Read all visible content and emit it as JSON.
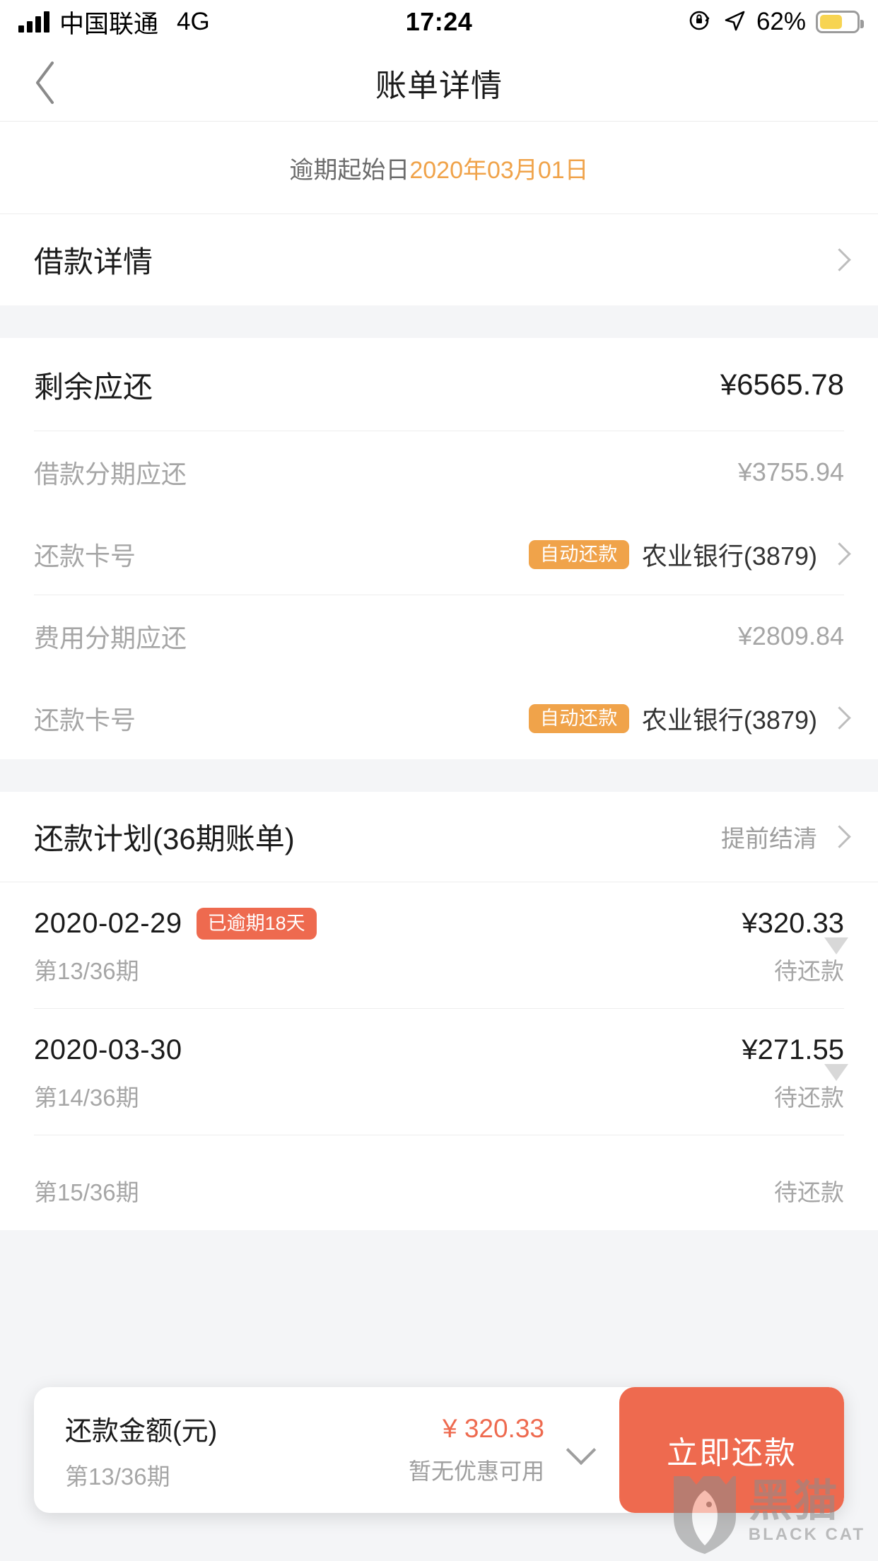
{
  "status_bar": {
    "carrier": "中国联通",
    "network": "4G",
    "time": "17:24",
    "battery_percent": "62%",
    "battery_level": 62,
    "icons": [
      "signal-bars-icon",
      "rotation-lock-icon",
      "location-arrow-icon",
      "battery-icon"
    ]
  },
  "nav": {
    "back_icon": "chevron-left-icon",
    "title": "账单详情"
  },
  "overdue": {
    "label": "逾期起始日",
    "date": "2020年03月01日",
    "accent_color": "#f0a34a"
  },
  "loan_detail_row": {
    "label": "借款详情",
    "chevron": "chevron-right-icon"
  },
  "summary": {
    "remaining": {
      "label": "剩余应还",
      "value": "¥6565.78"
    },
    "groups": [
      {
        "amount_label": "借款分期应还",
        "amount_value": "¥3755.94",
        "card_label": "还款卡号",
        "badge": "自动还款",
        "bank": "农业银行(3879)"
      },
      {
        "amount_label": "费用分期应还",
        "amount_value": "¥2809.84",
        "card_label": "还款卡号",
        "badge": "自动还款",
        "bank": "农业银行(3879)"
      }
    ]
  },
  "plan": {
    "title": "还款计划(36期账单)",
    "action": "提前结清",
    "rows": [
      {
        "date": "2020-02-29",
        "badge": "已逾期18天",
        "term": "第13/36期",
        "amount": "¥320.33",
        "status": "待还款"
      },
      {
        "date": "2020-03-30",
        "badge": "",
        "term": "第14/36期",
        "amount": "¥271.55",
        "status": "待还款"
      },
      {
        "date": "",
        "badge": "",
        "term": "第15/36期",
        "amount": "",
        "status": "待还款"
      }
    ]
  },
  "paybar": {
    "title": "还款金额(元)",
    "term": "第13/36期",
    "amount": "¥ 320.33",
    "coupon": "暂无优惠可用",
    "expand_icon": "chevron-down-icon",
    "button_label": "立即还款",
    "button_color": "#ee6a4f"
  },
  "watermark": {
    "cn": "黑猫",
    "en": "BLACK CAT"
  },
  "colors": {
    "accent_orange": "#f0a34a",
    "accent_coral": "#ee6a4f",
    "page_bg": "#f4f5f7",
    "card_bg": "#ffffff",
    "text_primary": "#1b1b1b",
    "text_muted": "#a6a6a6"
  }
}
